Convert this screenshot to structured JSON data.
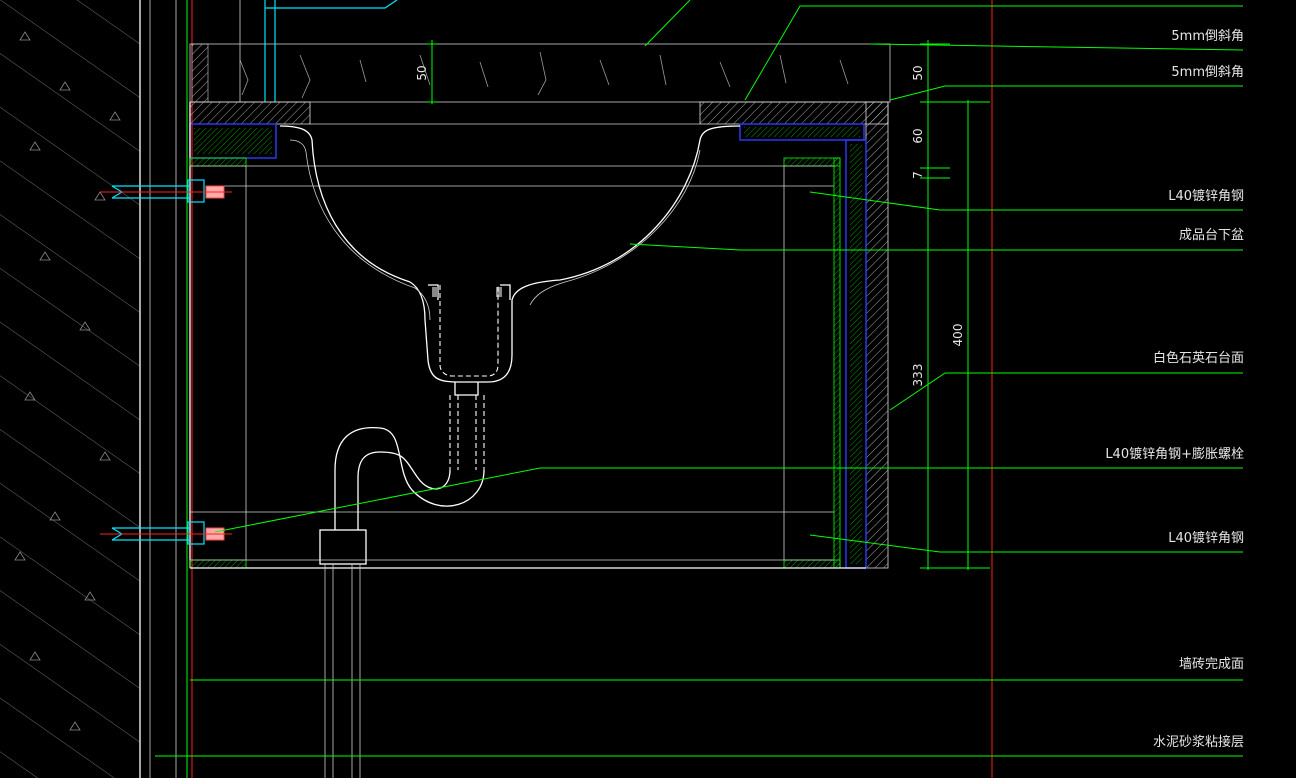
{
  "labels": {
    "chamfer_1": "5mm倒斜角",
    "chamfer_2": "5mm倒斜角",
    "angle_steel_1": "L40镀锌角钢",
    "undermount_basin": "成品台下盆",
    "marble_top": "白色石英石台面",
    "angle_steel_bolt": "L40镀锌角钢+膨胀螺栓",
    "angle_steel_2": "L40镀锌角钢",
    "tile_finish": "墙砖完成面",
    "mortar_layer": "水泥砂浆粘接层"
  },
  "dimensions": {
    "top_50_left": "50",
    "top_50_right": "50",
    "d60": "60",
    "d7": "7",
    "d400": "400",
    "d333": "333"
  },
  "colors": {
    "background": "#000000",
    "leader": "#00ff00",
    "outline": "#ffffff",
    "steel": "#2a3cff",
    "bolt": "#00e5ff",
    "axis": "#ff2020"
  }
}
